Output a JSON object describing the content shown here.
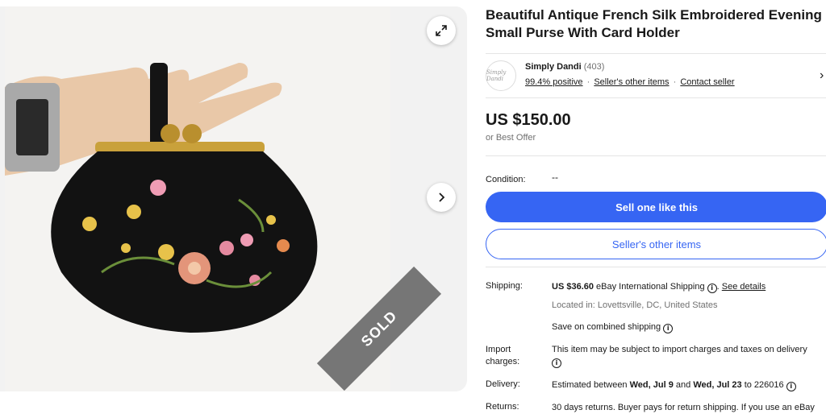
{
  "gallery": {
    "sold_label": "SOLD"
  },
  "listing": {
    "title": "Beautiful Antique French Silk Embroidered Evening Small Purse With Card Holder",
    "price": "US $150.00",
    "best_offer": "or Best Offer",
    "condition_label": "Condition:",
    "condition_value": "--"
  },
  "seller": {
    "avatar_text": "Simply Dandi",
    "name": "Simply Dandi",
    "feedback_count": "(403)",
    "positive": "99.4% positive",
    "sep": "·",
    "other_items_link": "Seller's other items",
    "contact": "Contact seller",
    "chevron": "›"
  },
  "buttons": {
    "sell_one": "Sell one like this",
    "other_items": "Seller's other items"
  },
  "shipping": {
    "label": "Shipping:",
    "cost": "US $36.60",
    "method": "eBay International Shipping",
    "see_details": "See details",
    "located": "Located in: Lovettsville, DC, United States",
    "combined": "Save on combined shipping"
  },
  "import": {
    "label1": "Import",
    "label2": "charges:",
    "text": "This item may be subject to import charges and taxes on delivery"
  },
  "delivery": {
    "label": "Delivery:",
    "prefix": "Estimated between",
    "date1": "Wed, Jul 9",
    "and": "and",
    "date2": "Wed, Jul 23",
    "to": "to 226016"
  },
  "returns": {
    "label": "Returns:",
    "text": "30 days returns. Buyer pays for return shipping. If you use an eBay"
  },
  "icons": {
    "info": "i"
  }
}
